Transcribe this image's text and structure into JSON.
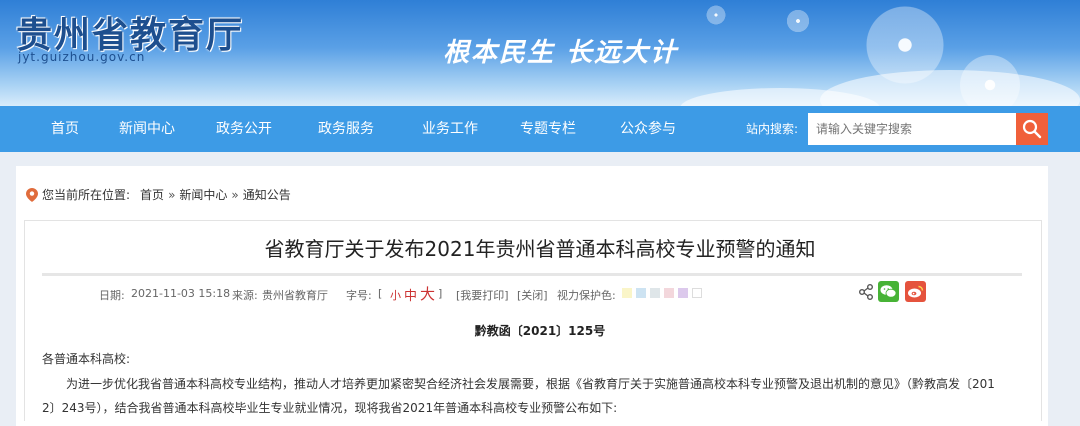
{
  "header": {
    "site_title": "贵州省教育厅",
    "site_domain": "jyt.guizhou.gov.cn",
    "slogan": "根本民生 长远大计"
  },
  "nav": {
    "items": [
      "首页",
      "新闻中心",
      "政务公开",
      "政务服务",
      "业务工作",
      "专题专栏",
      "公众参与"
    ],
    "search_label": "站内搜索:",
    "search_placeholder": "请输入关键字搜索",
    "search_icon": "search-icon"
  },
  "breadcrumb": {
    "prefix": "您当前所在位置:",
    "items": [
      "首页",
      "新闻中心",
      "通知公告"
    ],
    "separator": "»"
  },
  "article": {
    "title": "省教育厅关于发布2021年贵州省普通本科高校专业预警的通知",
    "meta": {
      "date_label": "日期:",
      "date": "2021-11-03 15:18",
      "source_label": "来源:",
      "source": "贵州省教育厅",
      "fontsize_label": "字号:",
      "bracket_open": "[",
      "bracket_close": "]",
      "small": "小",
      "medium": "中",
      "large": "大",
      "print": "[我要打印]",
      "close": "[关闭]",
      "eye_label": "视力保护色:",
      "eye_colors": [
        "#faf5c8",
        "#cde3f2",
        "#dfe6e9",
        "#f3d7dc",
        "#dcc9ec",
        "#ffffff"
      ]
    },
    "doc_number": "黔教函〔2021〕125号",
    "salutation": "各普通本科高校:",
    "paragraph_line1": "为进一步优化我省普通本科高校专业结构，推动人才培养更加紧密契合经济社会发展需要，根据《省教育厅关于实施普通高校本科专业预警及退出机制的意见》（黔教高发〔201",
    "paragraph_line2": "2〕243号），结合我省普通本科高校毕业生专业就业情况，现将我省2021年普通本科高校专业预警公布如下:"
  },
  "colors": {
    "nav_bg": "#3d9be6",
    "search_btn": "#f0603a",
    "wechat": "#47b336",
    "weibo": "#e5533d"
  }
}
